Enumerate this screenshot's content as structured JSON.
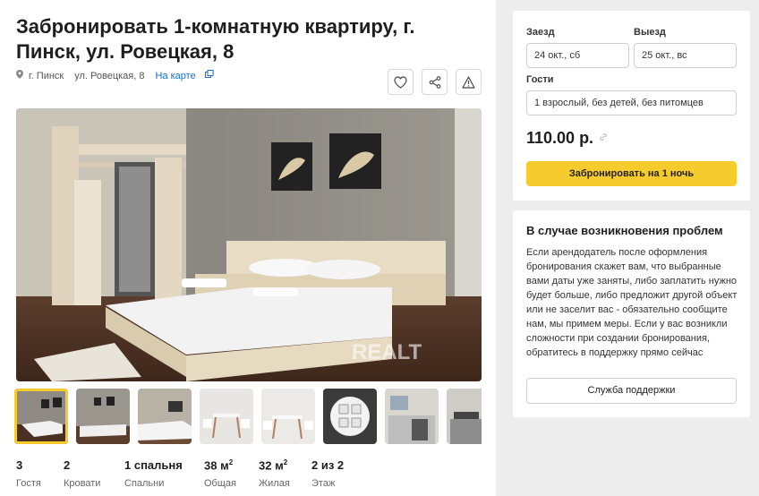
{
  "listing": {
    "title": "Забронировать 1-комнатную квартиру, г. Пинск, ул. Ровецкая, 8",
    "city": "г. Пинск",
    "street": "ул. Ровецкая, 8",
    "map_link": "На карте",
    "watermark": "REALT"
  },
  "stats": [
    {
      "value": "3",
      "label": "Гостя"
    },
    {
      "value": "2",
      "label": "Кровати"
    },
    {
      "value": "1 спальня",
      "label": "Спальни"
    },
    {
      "value": "38 м",
      "sup": "2",
      "label": "Общая"
    },
    {
      "value": "32 м",
      "sup": "2",
      "label": "Жилая"
    },
    {
      "value": "2 из 2",
      "label": "Этаж"
    }
  ],
  "booking": {
    "checkin_label": "Заезд",
    "checkin_value": "24 окт., сб",
    "checkout_label": "Выезд",
    "checkout_value": "25 окт., вс",
    "guests_label": "Гости",
    "guests_value": "1 взрослый, без детей, без питомцев",
    "price": "110.00 р.",
    "book_button": "Забронировать на 1 ночь"
  },
  "problems": {
    "title": "В случае возникновения проблем",
    "text": "Если арендодатель после оформления бронирования скажет вам, что выбранные вами даты уже заняты, либо заплатить нужно будет больше, либо предложит другой объект или не заселит вас - обязательно сообщите нам, мы примем меры. Если у вас возникли сложности при создании бронирования, обратитесь в поддержку прямо сейчас",
    "support_button": "Служба поддержки"
  },
  "colors": {
    "accent_yellow": "#f6cb2e",
    "link_blue": "#1a6fc9",
    "page_bg": "#ededed"
  },
  "icons": [
    "pin-icon",
    "copy-icon",
    "heart-icon",
    "share-icon",
    "warning-icon",
    "link-icon"
  ]
}
